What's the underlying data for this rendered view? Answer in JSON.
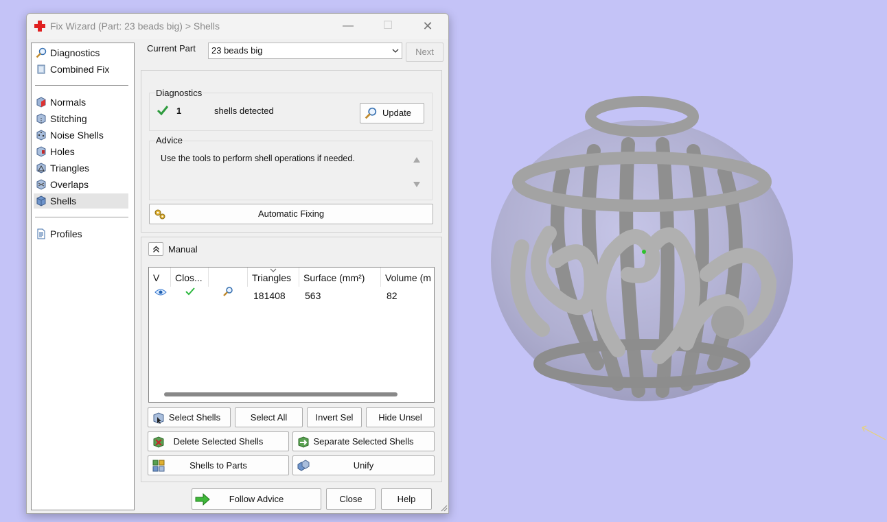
{
  "window": {
    "title": "Fix Wizard (Part: 23 beads big) > Shells",
    "minimize_glyph": "—",
    "maximize_glyph": "☐",
    "close_glyph": "✕"
  },
  "nav": {
    "items": [
      {
        "label": "Diagnostics",
        "icon": "magnifier-icon"
      },
      {
        "label": "Combined Fix",
        "icon": "combined-fix-icon"
      },
      {
        "label": "Normals",
        "icon": "normals-cube-icon"
      },
      {
        "label": "Stitching",
        "icon": "stitching-cube-icon"
      },
      {
        "label": "Noise Shells",
        "icon": "noise-shells-cube-icon"
      },
      {
        "label": "Holes",
        "icon": "holes-cube-icon"
      },
      {
        "label": "Triangles",
        "icon": "triangles-cube-icon"
      },
      {
        "label": "Overlaps",
        "icon": "overlaps-cube-icon"
      },
      {
        "label": "Shells",
        "icon": "shells-cube-icon",
        "selected": true
      },
      {
        "label": "Profiles",
        "icon": "document-icon"
      }
    ]
  },
  "current_part": {
    "label": "Current Part",
    "value": "23 beads big",
    "next_label": "Next"
  },
  "diagnostics": {
    "title": "Diagnostics",
    "count": "1",
    "text": "shells detected",
    "update_label": "Update"
  },
  "advice": {
    "title": "Advice",
    "text": "Use the tools to perform shell operations if needed."
  },
  "automatic_fixing_label": "Automatic Fixing",
  "manual": {
    "title": "Manual",
    "columns": [
      "V",
      "Clos...",
      "",
      "Triangles",
      "Surface (mm²)",
      "Volume (m"
    ],
    "row": {
      "triangles": "181408",
      "surface": "563",
      "volume": "82"
    }
  },
  "buttons": {
    "select_shells": "Select Shells",
    "select_all": "Select All",
    "invert_sel": "Invert Sel",
    "hide_unsel": "Hide Unsel",
    "delete_selected_shells": "Delete Selected Shells",
    "separate_selected_shells": "Separate Selected Shells",
    "shells_to_parts": "Shells to Parts",
    "unify": "Unify",
    "follow_advice": "Follow Advice",
    "close": "Close",
    "help": "Help"
  },
  "colors": {
    "viewport_background": "#c4c3f7",
    "model_gray": "#9a9a9a",
    "check_green": "#2e9b3e",
    "title_icon_red": "#e02020"
  }
}
